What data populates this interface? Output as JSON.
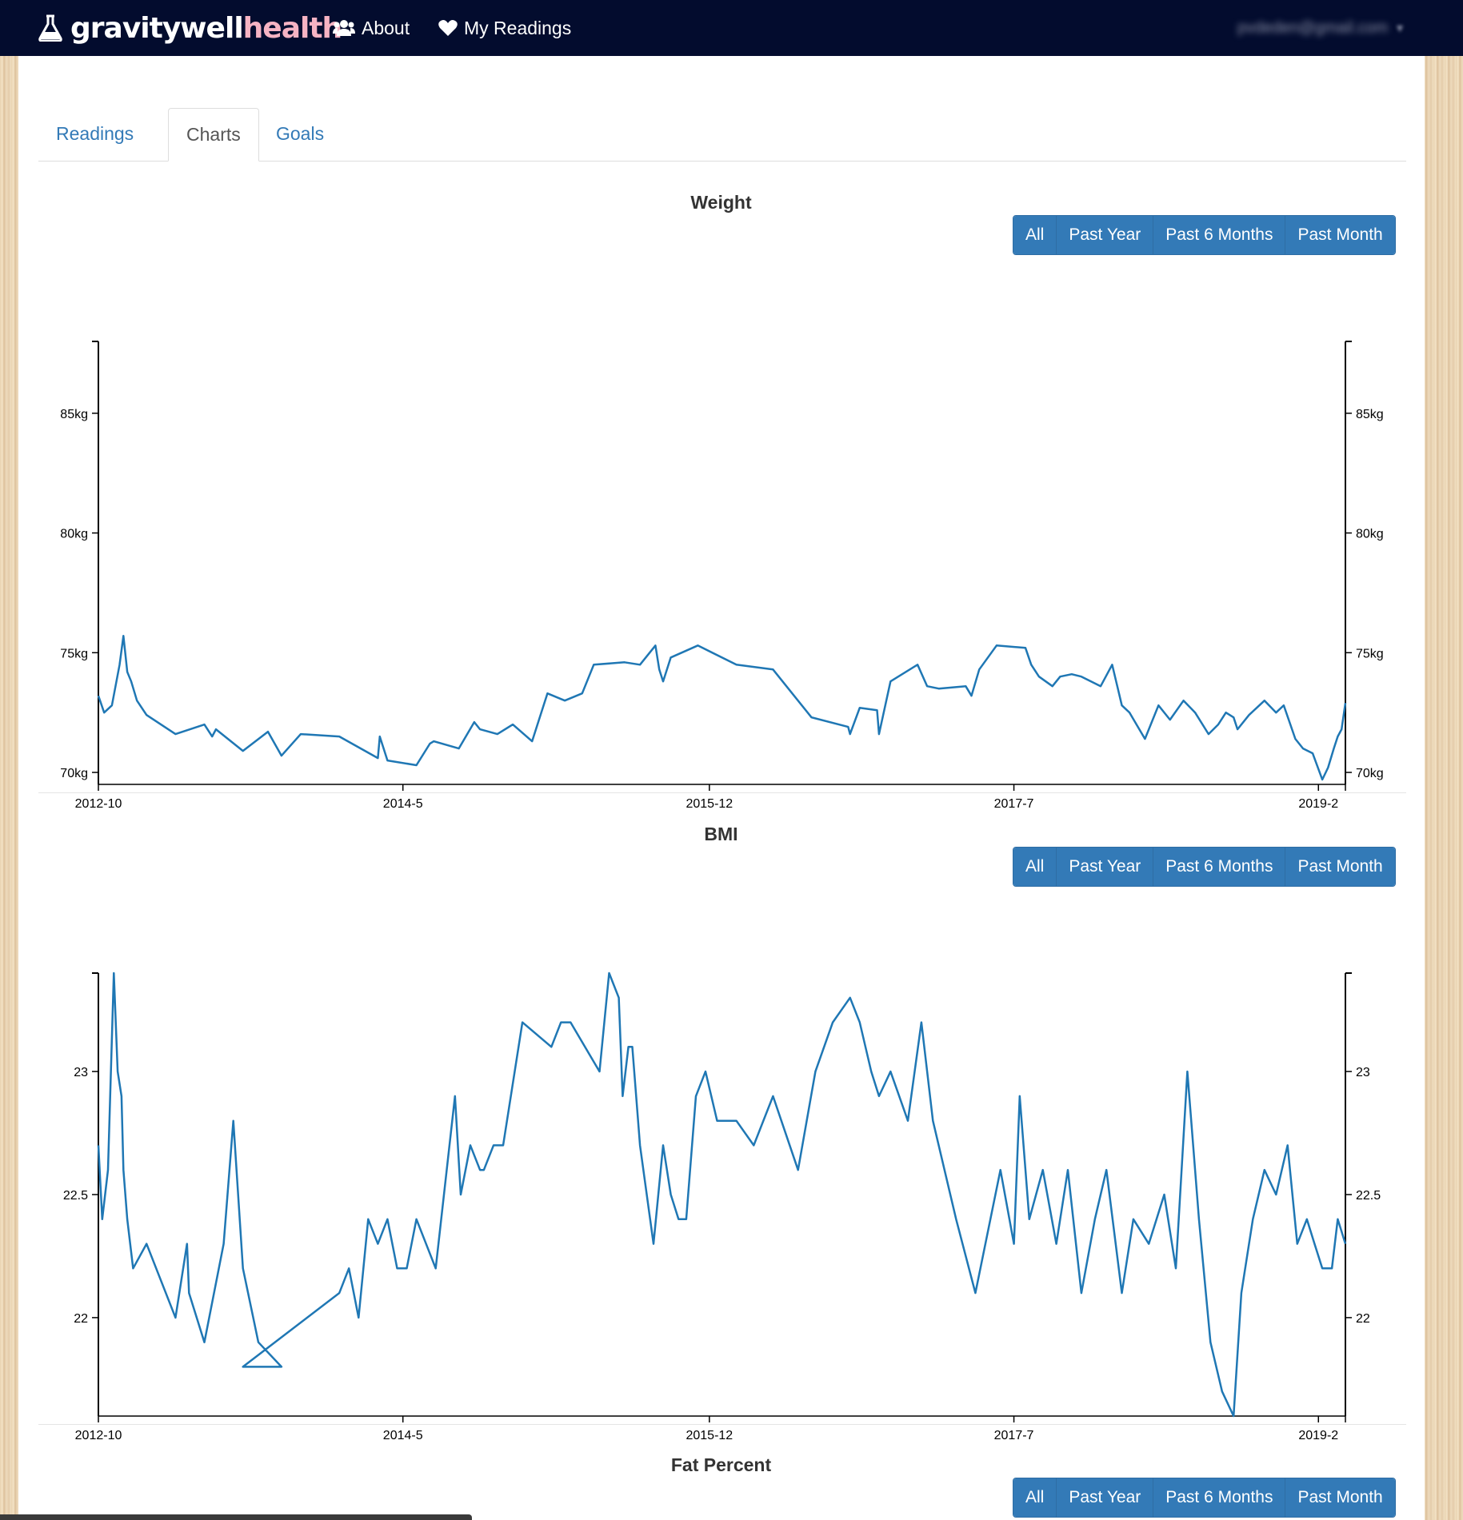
{
  "navbar": {
    "brand_part1": "gravitywell",
    "brand_part2": "health",
    "about_label": "About",
    "readings_label": "My Readings",
    "user_email": "pvdeden@gmail.com",
    "brand_pink": "#f6b3c3",
    "background": "#030c2e"
  },
  "tabs": [
    "Readings",
    "Charts",
    "Goals"
  ],
  "active_tab": "Charts",
  "range_buttons": [
    "All",
    "Past Year",
    "Past 6 Months",
    "Past Month"
  ],
  "selected_range": "All",
  "accent_color": "#337ab7",
  "line_color": "#1f77b4",
  "sections": [
    {
      "title": "Weight"
    },
    {
      "title": "BMI"
    },
    {
      "title": "Fat Percent"
    }
  ],
  "chart_data": [
    {
      "type": "line",
      "title": "Weight",
      "x_ticks": [
        "2012-10",
        "2014-5",
        "2015-12",
        "2017-7",
        "2019-2"
      ],
      "y_ticks": [
        "70kg",
        "75kg",
        "80kg",
        "85kg"
      ],
      "ylim": [
        69.5,
        88.0
      ],
      "x_label_positions": [
        2012.75,
        2014.33,
        2015.92,
        2017.5,
        2019.08
      ],
      "xlim": [
        2012.75,
        2019.22
      ],
      "series": [
        {
          "x": [
            2012.75,
            2012.78,
            2012.82,
            2012.86,
            2012.88,
            2012.9,
            2012.92,
            2012.95,
            2013.0,
            2013.15,
            2013.3,
            2013.34,
            2013.36,
            2013.5,
            2013.63,
            2013.7,
            2013.8,
            2014.0,
            2014.2,
            2014.21,
            2014.25,
            2014.4,
            2014.47,
            2014.49,
            2014.62,
            2014.7,
            2014.73,
            2014.82,
            2014.9,
            2015.0,
            2015.08,
            2015.17,
            2015.26,
            2015.32,
            2015.48,
            2015.56,
            2015.64,
            2015.66,
            2015.68,
            2015.72,
            2015.86,
            2016.06,
            2016.25,
            2016.45,
            2016.64,
            2016.65,
            2016.7,
            2016.79,
            2016.8,
            2016.86,
            2017.0,
            2017.05,
            2017.11,
            2017.25,
            2017.28,
            2017.32,
            2017.41,
            2017.56,
            2017.59,
            2017.63,
            2017.7,
            2017.74,
            2017.8,
            2017.85,
            2017.95,
            2018.01,
            2018.06,
            2018.1,
            2018.18,
            2018.25,
            2018.31,
            2018.38,
            2018.44,
            2018.51,
            2018.56,
            2018.6,
            2018.64,
            2018.66,
            2018.72,
            2018.8,
            2018.86,
            2018.9,
            2018.96,
            2019.0,
            2019.05,
            2019.1,
            2019.13,
            2019.16,
            2019.18,
            2019.2,
            2019.22
          ],
          "y": [
            73.2,
            72.5,
            72.8,
            74.5,
            75.7,
            74.2,
            73.8,
            73.0,
            72.4,
            71.6,
            72.0,
            71.5,
            71.8,
            70.9,
            71.7,
            70.7,
            71.6,
            71.5,
            70.6,
            71.5,
            70.5,
            70.3,
            71.2,
            71.3,
            71.0,
            72.1,
            71.8,
            71.6,
            72.0,
            71.3,
            73.3,
            73.0,
            73.3,
            74.5,
            74.6,
            74.5,
            75.3,
            74.3,
            73.8,
            74.8,
            75.3,
            74.5,
            74.3,
            72.3,
            71.9,
            71.6,
            72.7,
            72.6,
            71.6,
            73.8,
            74.5,
            73.6,
            73.5,
            73.6,
            73.2,
            74.3,
            75.3,
            75.2,
            74.5,
            74.0,
            73.6,
            74.0,
            74.1,
            74.0,
            73.6,
            74.5,
            72.8,
            72.5,
            71.4,
            72.8,
            72.2,
            73.0,
            72.5,
            71.6,
            72.0,
            72.5,
            72.3,
            71.8,
            72.4,
            73.0,
            72.5,
            72.8,
            71.4,
            71.0,
            70.8,
            69.7,
            70.2,
            71.0,
            71.5,
            71.8,
            72.9
          ]
        }
      ]
    },
    {
      "type": "line",
      "title": "BMI",
      "x_ticks": [
        "2012-10",
        "2014-5",
        "2015-12",
        "2017-7",
        "2019-2"
      ],
      "y_ticks": [
        "22",
        "22.5",
        "23"
      ],
      "ylim": [
        21.6,
        23.4
      ],
      "x_label_positions": [
        2012.75,
        2014.33,
        2015.92,
        2017.5,
        2019.08
      ],
      "xlim": [
        2012.75,
        2019.22
      ],
      "series": [
        {
          "x": [
            2012.75,
            2012.77,
            2012.8,
            2012.83,
            2012.85,
            2012.87,
            2012.88,
            2012.9,
            2012.93,
            2013.0,
            2013.15,
            2013.21,
            2013.22,
            2013.3,
            2013.4,
            2013.45,
            2013.5,
            2013.58,
            2013.7,
            213.75,
            2014.0,
            2014.05,
            2014.1,
            2014.15,
            2014.2,
            2014.25,
            2014.3,
            2014.35,
            2014.4,
            2014.5,
            2014.6,
            2014.63,
            2014.68,
            2014.73,
            2014.75,
            2014.8,
            2014.85,
            2014.95,
            2015.1,
            2015.15,
            2015.2,
            2015.35,
            2015.4,
            2015.45,
            2015.47,
            2015.5,
            2015.52,
            2015.56,
            2015.63,
            2015.68,
            2015.72,
            2015.76,
            2015.8,
            2015.85,
            2015.9,
            2015.96,
            2016.06,
            2016.15,
            2016.25,
            2016.38,
            2016.47,
            2016.56,
            2016.65,
            2016.7,
            2016.76,
            2016.8,
            2016.86,
            2016.95,
            2017.02,
            2017.08,
            2017.2,
            2017.3,
            2017.43,
            2017.5,
            2017.53,
            2017.58,
            2017.65,
            2017.72,
            2017.78,
            2017.85,
            2017.92,
            2017.98,
            2018.06,
            2018.12,
            2018.2,
            2018.28,
            2018.34,
            2018.4,
            2018.46,
            2018.52,
            2018.58,
            2018.64,
            2018.68,
            2018.74,
            2018.8,
            2018.86,
            2018.92,
            2018.97,
            2019.02,
            2019.06,
            2019.1,
            2019.15,
            2019.18,
            2019.22
          ],
          "y": [
            22.7,
            22.4,
            22.6,
            23.4,
            23.0,
            22.9,
            22.6,
            22.4,
            22.2,
            22.3,
            22.0,
            22.3,
            22.1,
            21.9,
            22.3,
            22.8,
            22.2,
            21.9,
            21.8,
            21.8,
            22.1,
            22.2,
            22.0,
            22.4,
            22.3,
            22.4,
            22.2,
            22.2,
            22.4,
            22.2,
            22.9,
            22.5,
            22.7,
            22.6,
            22.6,
            22.7,
            22.7,
            23.2,
            23.1,
            23.2,
            23.2,
            23.0,
            23.4,
            23.3,
            22.9,
            23.1,
            23.1,
            22.7,
            22.3,
            22.7,
            22.5,
            22.4,
            22.4,
            22.9,
            23.0,
            22.8,
            22.8,
            22.7,
            22.9,
            22.6,
            23.0,
            23.2,
            23.3,
            23.2,
            23.0,
            22.9,
            23.0,
            22.8,
            23.2,
            22.8,
            22.4,
            22.1,
            22.6,
            22.3,
            22.9,
            22.4,
            22.6,
            22.3,
            22.6,
            22.1,
            22.4,
            22.6,
            22.1,
            22.4,
            22.3,
            22.5,
            22.2,
            23.0,
            22.4,
            21.9,
            21.7,
            21.6,
            22.1,
            22.4,
            22.6,
            22.5,
            22.7,
            22.3,
            22.4,
            22.3,
            22.2,
            22.2,
            22.4,
            22.3
          ]
        }
      ]
    }
  ]
}
